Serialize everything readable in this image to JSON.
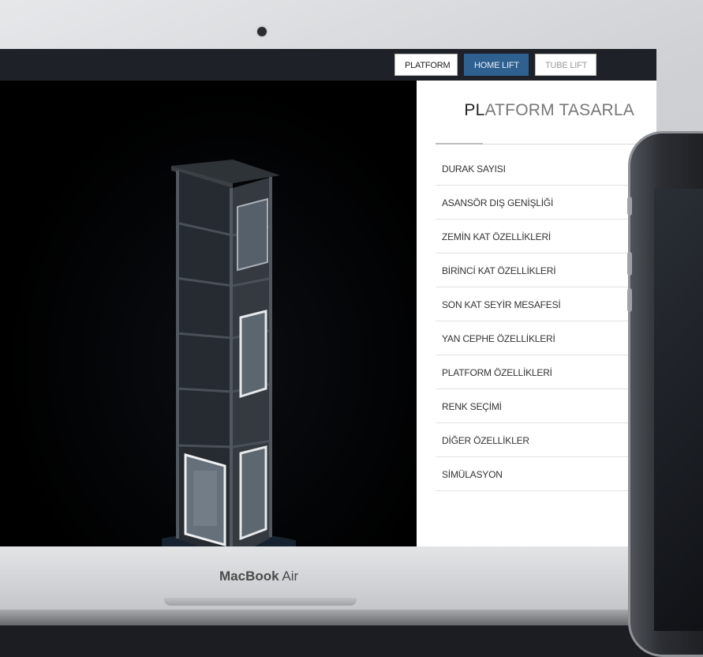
{
  "device": {
    "brand_prefix": "MacBook",
    "brand_suffix": " Air"
  },
  "tabs": [
    {
      "label": "PLATFORM",
      "state": "selected"
    },
    {
      "label": "HOME LIFT",
      "state": "inactive"
    },
    {
      "label": "TUBE LIFT",
      "state": "disabled"
    }
  ],
  "panel": {
    "title_bold": "PL",
    "title_rest": "ATFORM TASARLA"
  },
  "menu": [
    {
      "label": "DURAK SAYISI"
    },
    {
      "label": "ASANSÖR DIŞ GENİŞLİĞİ"
    },
    {
      "label": "ZEMİN KAT ÖZELLİKLERİ"
    },
    {
      "label": "BİRİNCİ KAT ÖZELLİKLERİ"
    },
    {
      "label": "SON KAT SEYİR MESAFESİ"
    },
    {
      "label": "YAN CEPHE ÖZELLİKLERİ"
    },
    {
      "label": "PLATFORM ÖZELLİKLERİ"
    },
    {
      "label": "RENK SEÇİMİ"
    },
    {
      "label": "DİĞER ÖZELLİKLER"
    },
    {
      "label": "SİMÜLASYON"
    }
  ],
  "colors": {
    "accent": "#2f6190",
    "panel_bg": "#ffffff",
    "stage_bg": "#000000"
  }
}
